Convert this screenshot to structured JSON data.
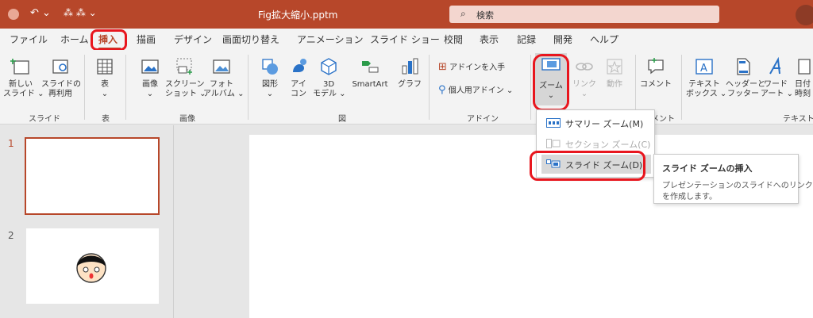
{
  "titlebar": {
    "filename": "Fig拡大縮小.pptm",
    "search_label": "検索"
  },
  "tabs": [
    "ファイル",
    "ホーム",
    "挿入",
    "描画",
    "デザイン",
    "画面切り替え",
    "アニメーション",
    "スライド ショー",
    "校閲",
    "表示",
    "記録",
    "開発",
    "ヘルプ"
  ],
  "ribbon": {
    "new_slide": [
      "新しい",
      "スライド ⌄"
    ],
    "reuse_slide": [
      "スライドの",
      "再利用"
    ],
    "table": [
      "表",
      "⌄"
    ],
    "images": [
      "画像",
      "⌄"
    ],
    "screenshot": [
      "スクリーン",
      "ショット ⌄"
    ],
    "photo_album": [
      "フォト",
      "アルバム ⌄"
    ],
    "shapes": [
      "図形",
      "⌄"
    ],
    "icons": [
      "アイ",
      "コン"
    ],
    "models3d": [
      "3D",
      "モデル ⌄"
    ],
    "smartart": "SmartArt",
    "chart": "グラフ",
    "get_addins": "アドインを入手",
    "my_addins": "個人用アドイン ⌄",
    "zoom": [
      "ズーム",
      "⌄"
    ],
    "link": [
      "リンク",
      "⌄"
    ],
    "action": "動作",
    "comment": "コメント",
    "textbox": [
      "テキスト",
      "ボックス ⌄"
    ],
    "header_footer": [
      "ヘッダーと",
      "フッター"
    ],
    "wordart": [
      "ワード",
      "アート ⌄"
    ],
    "datetime": [
      "日付",
      "時刻"
    ],
    "groups": {
      "slides": "スライド",
      "tables": "表",
      "images": "画像",
      "illustrations": "図",
      "addins": "アドイン",
      "comments": "メント",
      "text": "テキスト"
    }
  },
  "slides": [
    {
      "number": "1"
    },
    {
      "number": "2"
    }
  ],
  "zoom_menu": {
    "items": [
      {
        "label": "サマリー ズーム(M)",
        "enabled": true
      },
      {
        "label": "セクション ズーム(C)",
        "enabled": false
      },
      {
        "label": "スライド ズーム(D)",
        "enabled": true,
        "highlighted": true
      }
    ]
  },
  "tooltip": {
    "title": "スライド ズームの挿入",
    "body": [
      "プレゼンテーションのスライドへのリンク",
      "を作成します。"
    ]
  },
  "colors": {
    "accent": "#b7472a",
    "highlight_border": "#e8161e",
    "ribbon_bg": "#f3f3f3"
  }
}
